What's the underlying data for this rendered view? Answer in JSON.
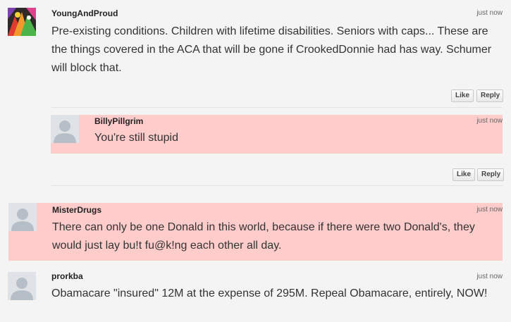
{
  "comments": [
    {
      "author": "YoungAndProud",
      "time": "just now",
      "avatar_icon": "colorful-figures-icon",
      "text": "Pre-existing conditions. Children with lifetime disabilities. Seniors with caps... These are the things covered in the ACA that will be gone if CrookedDonnie had has way. Schumer will block that.",
      "like_label": "Like",
      "reply_label": "Reply"
    },
    {
      "author": "BillyPillgrim",
      "time": "just now",
      "avatar_icon": "default-user-icon",
      "text": "You're still stupid",
      "like_label": "Like",
      "reply_label": "Reply",
      "highlight_color": "#ffcccc"
    },
    {
      "author": "MisterDrugs",
      "time": "just now",
      "avatar_icon": "default-user-icon",
      "text": "There can only be one Donald in this world, because if there were two Donald's, they would just lay bu!t fu@k!ng each other all day.",
      "highlight_color": "#ffcccc"
    },
    {
      "author": "prorkba",
      "time": "just now",
      "avatar_icon": "default-user-icon",
      "text": "Obamacare \"insured\" 12M at the expense of 295M.  Repeal Obamacare, entirely, NOW!"
    }
  ]
}
